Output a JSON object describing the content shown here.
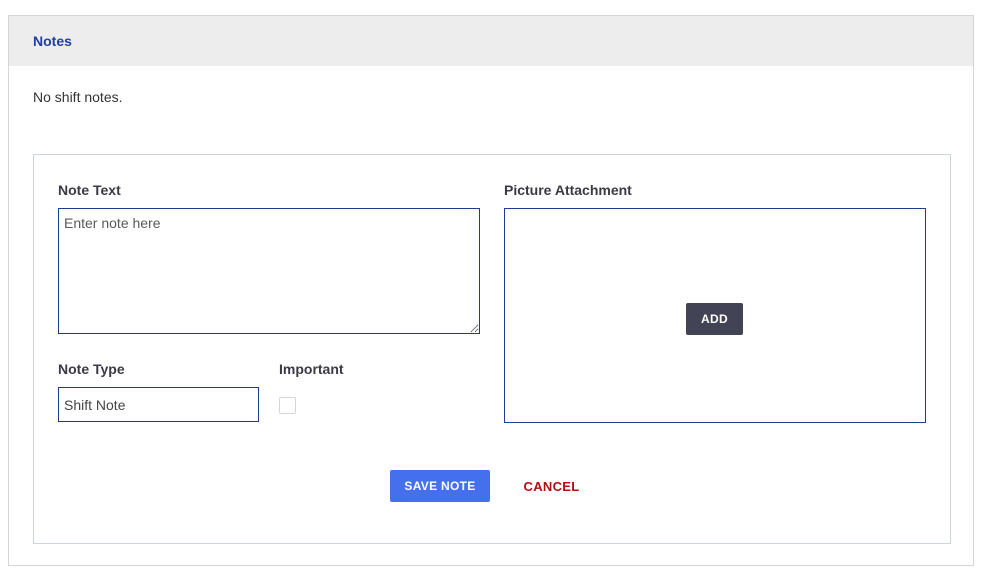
{
  "panel": {
    "title": "Notes",
    "empty_message": "No shift notes."
  },
  "form": {
    "note_text": {
      "label": "Note Text",
      "placeholder": "Enter note here",
      "value": ""
    },
    "note_type": {
      "label": "Note Type",
      "value": "Shift Note"
    },
    "important": {
      "label": "Important",
      "checked": false
    },
    "picture_attachment": {
      "label": "Picture Attachment",
      "add_label": "ADD"
    },
    "save_label": "SAVE NOTE",
    "cancel_label": "CANCEL"
  },
  "colors": {
    "header_bg": "#ededed",
    "title": "#1f3fa0",
    "field_border": "#1d3e8f",
    "save_button": "#4470ee",
    "add_button": "#434356",
    "cancel_text": "#b40d16"
  }
}
